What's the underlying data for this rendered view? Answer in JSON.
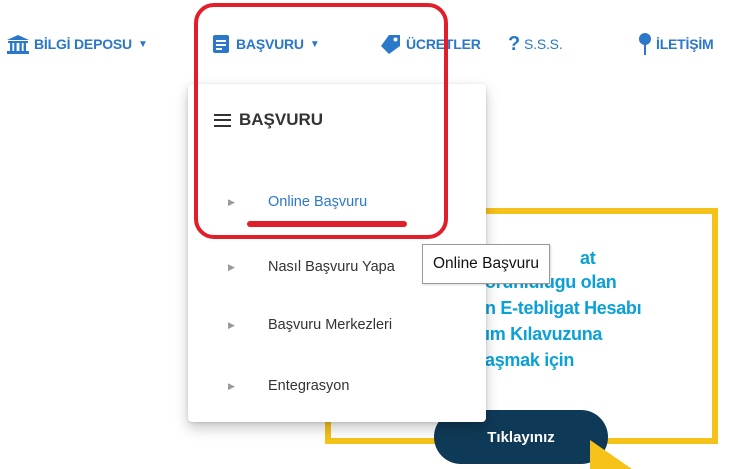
{
  "nav": {
    "items": [
      {
        "label": "BİLGİ DEPOSU",
        "icon": "bank-icon"
      },
      {
        "label": "BAŞVURU",
        "icon": "document-icon"
      },
      {
        "label": "ÜCRETLER",
        "icon": "tag-icon"
      },
      {
        "label": "S.S.S.",
        "icon": "question-icon"
      },
      {
        "label": "İLETİŞİM",
        "icon": "map-pin-icon"
      }
    ],
    "caret_icon": "caret-down-icon"
  },
  "dropdown": {
    "header": "BAŞVURU",
    "header_icon": "hamburger-icon",
    "items": [
      {
        "label": "Online Başvuru",
        "active": true
      },
      {
        "label": "Nasıl Başvuru Yapa"
      },
      {
        "label": "Başvuru Merkezleri"
      },
      {
        "label": "Entegrasyon"
      }
    ],
    "arrow_icon": "caret-right-icon"
  },
  "tooltip": "Online Başvuru",
  "banner": {
    "lines": [
      "at",
      "oruniuiugu olan",
      "n E-tebligat Hesabı",
      "ım Kılavuzuna",
      "aşmak için"
    ],
    "button": "Tıklayınız"
  },
  "colors": {
    "nav_blue": "#2b77c9",
    "banner_text": "#0ba1d6",
    "banner_border": "#f5c21a",
    "button_bg": "#0f3a57",
    "highlight_red": "#e01f2a"
  }
}
